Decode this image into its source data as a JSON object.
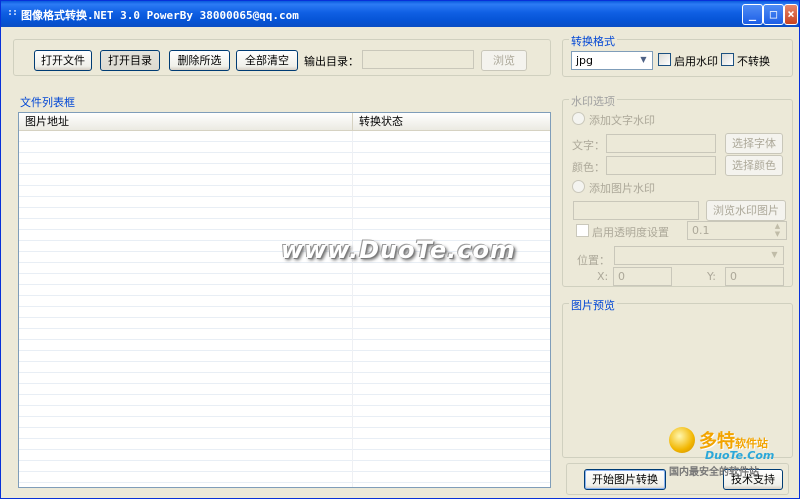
{
  "window": {
    "title": "图像格式转换.NET 3.0 PowerBy 38000065@qq.com",
    "icon_glyph": "::",
    "controls": {
      "minimize": "_",
      "maximize": "□",
      "close": "×"
    }
  },
  "toolbar": {
    "open_file": "打开文件",
    "open_dir": "打开目录",
    "delete_selected": "删除所选",
    "clear_all": "全部清空",
    "output_dir_label": "输出目录：",
    "output_dir_value": "",
    "browse": "浏览"
  },
  "file_list": {
    "title": "文件列表框",
    "columns": [
      "图片地址",
      "转换状态"
    ],
    "rows": []
  },
  "format": {
    "title": "转换格式",
    "selected": "jpg",
    "enable_watermark": "启用水印",
    "no_convert": "不转换"
  },
  "watermark": {
    "title": "水印选项",
    "add_text": "添加文字水印",
    "text_label": "文字：",
    "text_value": "",
    "choose_font": "选择字体",
    "color_label": "颜色：",
    "color_value": "",
    "choose_color": "选择颜色",
    "add_image": "添加图片水印",
    "image_path": "",
    "browse_image": "浏览水印图片",
    "transparency_label": "启用透明度设置",
    "transparency_value": "0.1",
    "position_label": "位置：",
    "position_value": "",
    "x_label": "X:",
    "x_value": "0",
    "y_label": "Y:",
    "y_value": "0"
  },
  "preview": {
    "title": "图片预览"
  },
  "actions": {
    "start": "开始图片转换",
    "support": "技术支持"
  },
  "overlay": {
    "watermark_text": "www.DuoTe.com",
    "logo_cn": "多特",
    "logo_cn_small": "软件站",
    "logo_en": "DuoTe.Com",
    "logo_sub": "国内最安全的软件站"
  },
  "colors": {
    "titlebar": "#0a5bdc",
    "face": "#ece9d8",
    "group_title": "#0046d5"
  }
}
